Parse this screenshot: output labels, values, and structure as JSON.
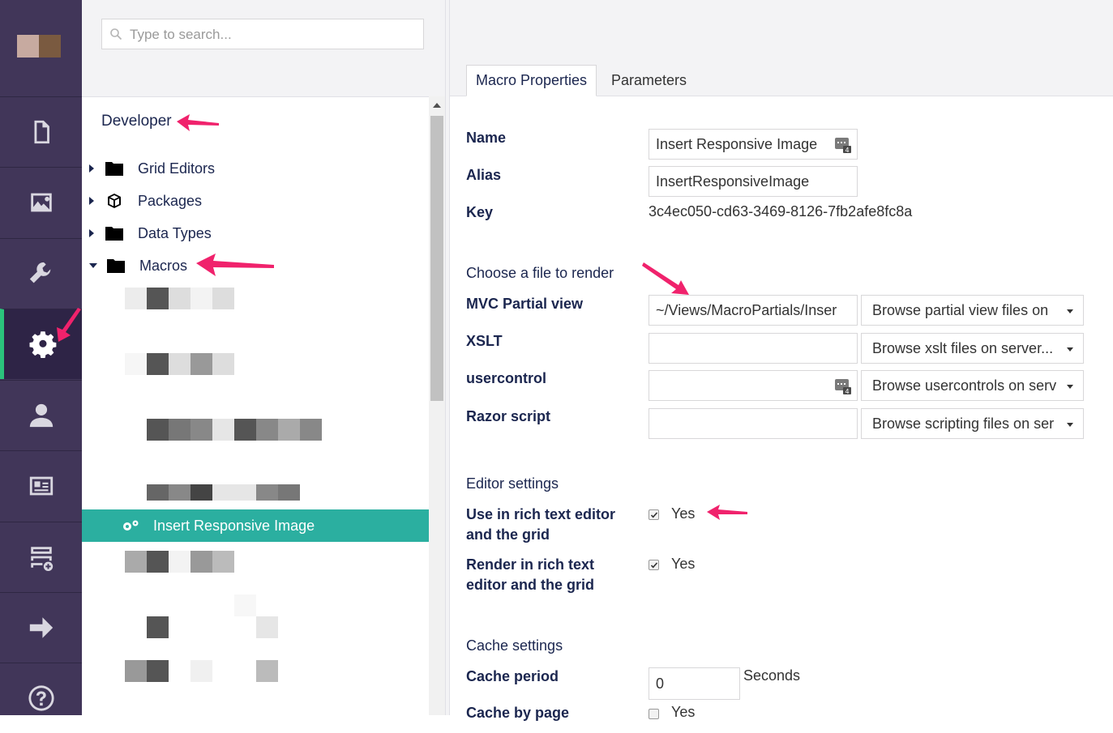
{
  "colors": {
    "nav_bg": "#413659",
    "selected_bg": "#2bafa0",
    "arrow": "#f0226c",
    "active_indicator": "#2bc37c"
  },
  "nav": {
    "items": [
      "content-icon",
      "media-icon",
      "settings-icon",
      "developer-icon",
      "users-icon",
      "members-icon",
      "forms-icon",
      "deploy-icon",
      "help-icon"
    ],
    "active": "developer"
  },
  "search": {
    "placeholder": "Type to search..."
  },
  "tree": {
    "root": "Developer",
    "nodes": [
      {
        "label": "Grid Editors",
        "icon": "folder-icon",
        "expanded": false
      },
      {
        "label": "Packages",
        "icon": "package-icon",
        "expanded": false
      },
      {
        "label": "Data Types",
        "icon": "folder-icon",
        "expanded": false
      },
      {
        "label": "Macros",
        "icon": "folder-icon",
        "expanded": true
      }
    ],
    "selected": {
      "label": "Insert Responsive Image",
      "icon": "macro-icon"
    }
  },
  "tabs": [
    {
      "label": "Macro Properties",
      "active": true
    },
    {
      "label": "Parameters",
      "active": false
    }
  ],
  "form": {
    "name": {
      "label": "Name",
      "value": "Insert Responsive Image"
    },
    "alias": {
      "label": "Alias",
      "value": "InsertResponsiveImage"
    },
    "key": {
      "label": "Key",
      "value": "3c4ec050-cd63-3469-8126-7fb2afe8fc8a"
    },
    "render_section": "Choose a file to render",
    "mvc": {
      "label": "MVC Partial view",
      "value": "~/Views/MacroPartials/Inser",
      "browse": "Browse partial view files on"
    },
    "xslt": {
      "label": "XSLT",
      "value": "",
      "browse": "Browse xslt files on server..."
    },
    "usercontrol": {
      "label": "usercontrol",
      "value": "",
      "browse": "Browse usercontrols on serv"
    },
    "razor": {
      "label": "Razor script",
      "value": "",
      "browse": "Browse scripting files on ser"
    },
    "editor_section": "Editor settings",
    "use_rte": {
      "label_line1": "Use in rich text editor",
      "label_line2": "and the grid",
      "checked": true,
      "text": "Yes"
    },
    "render_rte": {
      "label_line1": "Render in rich text",
      "label_line2": "editor and the grid",
      "checked": true,
      "text": "Yes"
    },
    "cache_section": "Cache settings",
    "cache_period": {
      "label": "Cache period",
      "value": "0",
      "unit": "Seconds"
    },
    "cache_by_page": {
      "label": "Cache by page",
      "checked": false,
      "text": "Yes"
    }
  }
}
